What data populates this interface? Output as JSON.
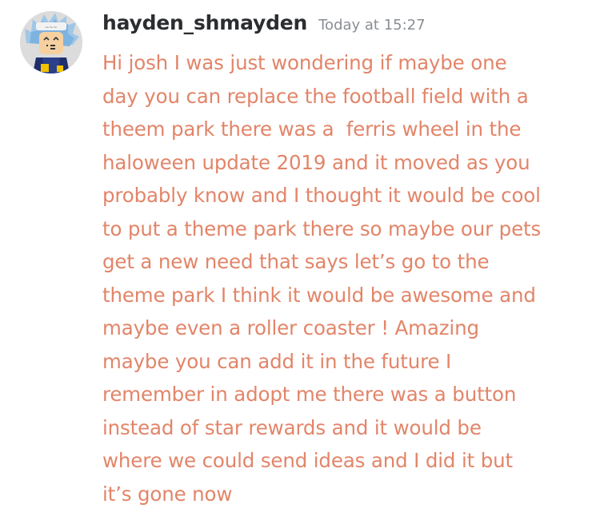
{
  "message": {
    "author": "hayden_shmayden",
    "timestamp": "Today at 15:27",
    "avatar_icon": "roblox-avatar-icon",
    "text_color": "#e28569",
    "lines": [
      "Hi josh I was just wondering if maybe one",
      "day you can replace the football field with a",
      "theem park there was a  ferris wheel in the",
      "haloween update 2019 and it moved as you",
      "probably know and I thought it would be cool",
      "to put a theme park there so maybe our pets",
      "get a new need that says let’s go to the",
      "theme park I think it would be awesome and",
      "maybe even a roller coaster ! Amazing",
      "maybe you can add it in the future I",
      "remember in adopt me there was a button",
      "instead of star rewards and it would be",
      "where we could send ideas and I did it but",
      "it’s gone now"
    ]
  }
}
